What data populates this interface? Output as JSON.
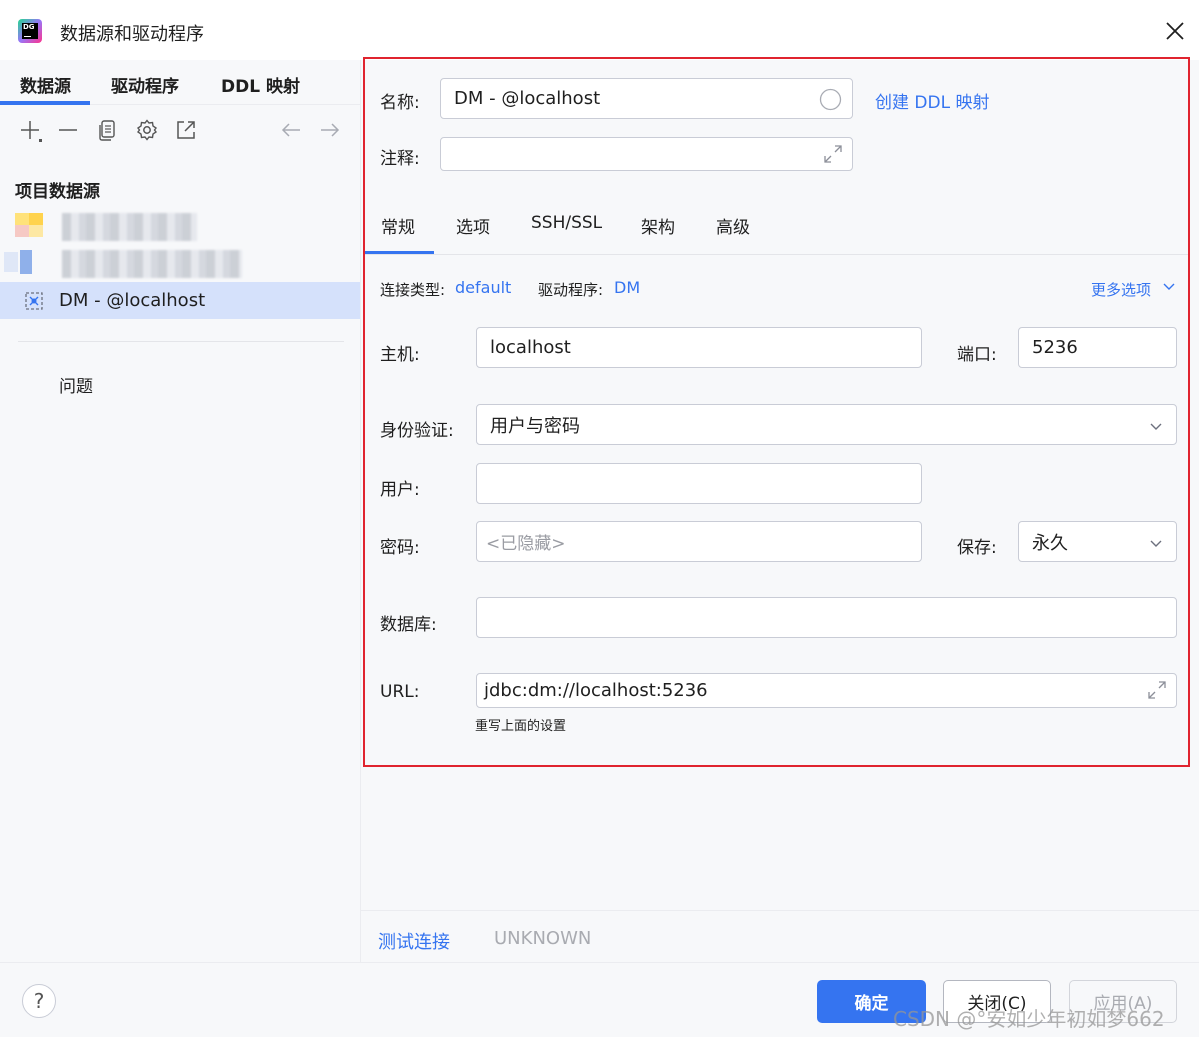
{
  "window": {
    "title": "数据源和驱动程序",
    "logo_text": "DG"
  },
  "left": {
    "tabs": [
      {
        "label": "数据源",
        "active": true
      },
      {
        "label": "驱动程序",
        "active": false
      },
      {
        "label": "DDL 映射",
        "active": false
      }
    ],
    "toolbar_icons": [
      "add-icon",
      "remove-icon",
      "copy-icon",
      "settings-icon",
      "export-icon",
      "back-arrow-icon",
      "forward-arrow-icon"
    ],
    "section_title": "项目数据源",
    "selected_item": "DM - @localhost",
    "problems_label": "问题"
  },
  "form": {
    "name_label": "名称:",
    "name_value": "DM - @localhost",
    "create_ddl_link": "创建 DDL 映射",
    "comment_label": "注释:",
    "comment_value": "",
    "tabs": [
      {
        "label": "常规",
        "active": true
      },
      {
        "label": "选项",
        "active": false
      },
      {
        "label": "SSH/SSL",
        "active": false
      },
      {
        "label": "架构",
        "active": false
      },
      {
        "label": "高级",
        "active": false
      }
    ],
    "connection_type_label": "连接类型:",
    "connection_type_value": "default",
    "driver_label": "驱动程序:",
    "driver_value": "DM",
    "more_options": "更多选项",
    "host_label": "主机:",
    "host_value": "localhost",
    "port_label": "端口:",
    "port_value": "5236",
    "auth_label": "身份验证:",
    "auth_value": "用户与密码",
    "user_label": "用户:",
    "user_value": "",
    "password_label": "密码:",
    "password_placeholder": "<已隐藏>",
    "save_label": "保存:",
    "save_value": "永久",
    "database_label": "数据库:",
    "database_value": "",
    "url_label": "URL:",
    "url_value": "jdbc:dm://localhost:5236",
    "url_hint": "重写上面的设置"
  },
  "bottom": {
    "test_connection": "测试连接",
    "status": "UNKNOWN"
  },
  "footer": {
    "help": "?",
    "ok_label": "确定",
    "close_label": "关闭(C)",
    "apply_label": "应用(A)"
  },
  "watermark": "CSDN @°安如少年初如梦662",
  "colors": {
    "accent": "#3574f0",
    "highlight_border": "#e0242f",
    "selection": "#d5e1fb"
  }
}
